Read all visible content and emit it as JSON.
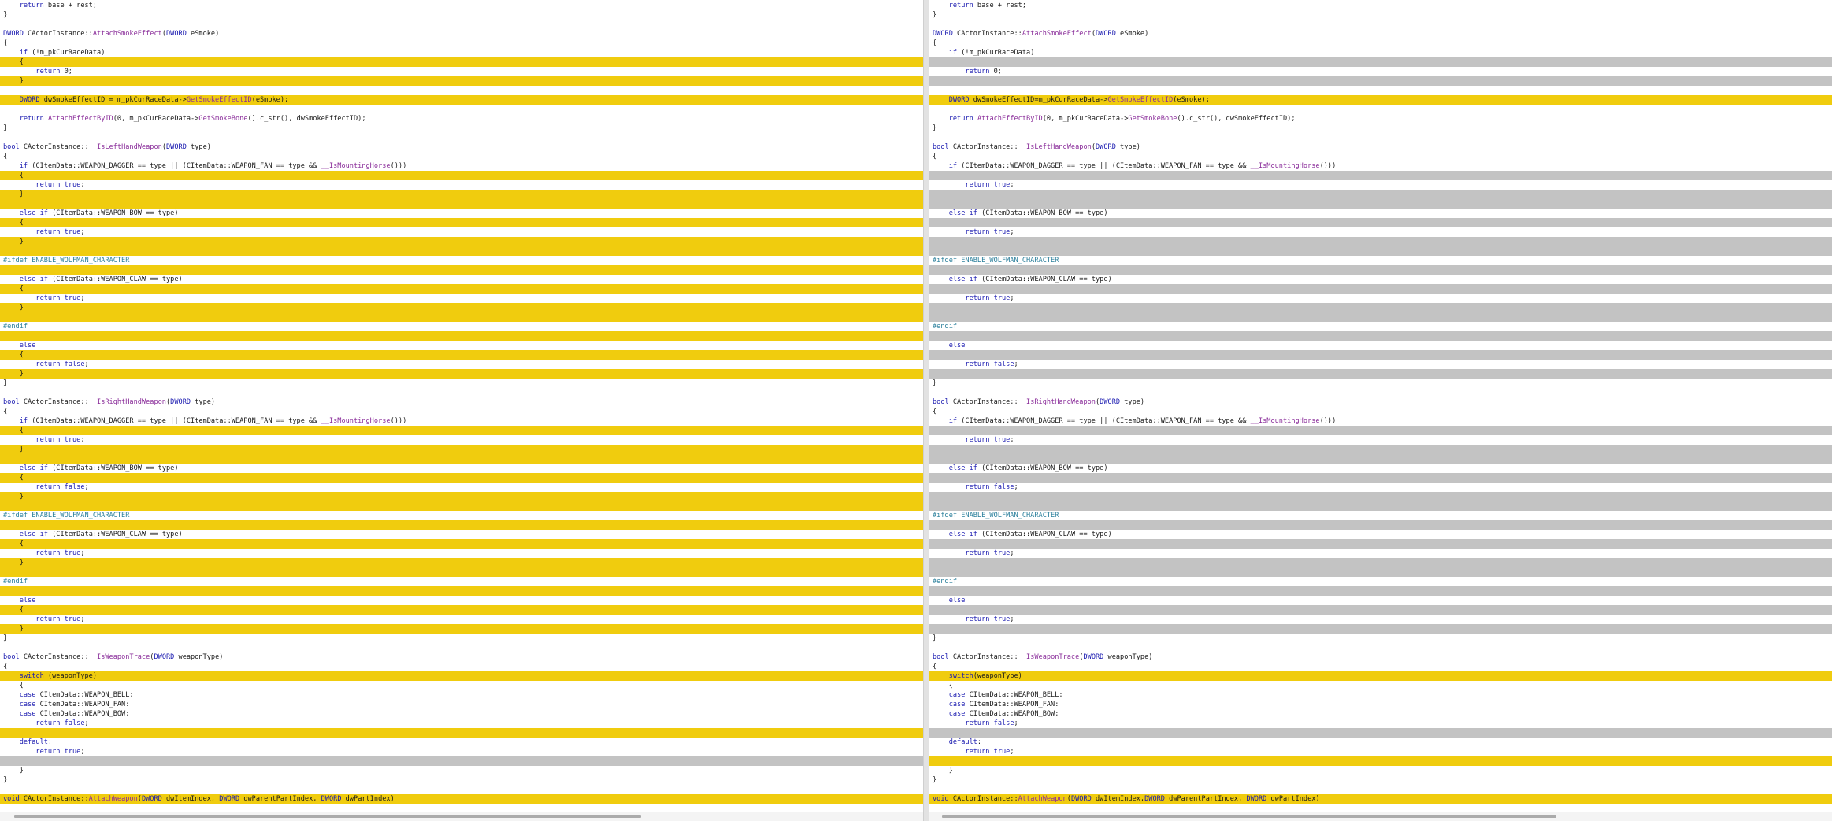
{
  "left": [
    {
      "t": "    return base + rest;",
      "s": "n"
    },
    {
      "t": "}",
      "s": "n"
    },
    {
      "t": "",
      "s": "n"
    },
    {
      "t": "DWORD CActorInstance::AttachSmokeEffect(DWORD eSmoke)",
      "s": "n"
    },
    {
      "t": "{",
      "s": "n"
    },
    {
      "t": "    if (!m_pkCurRaceData)",
      "s": "n"
    },
    {
      "t": "    {",
      "s": "ch"
    },
    {
      "t": "        return 0;",
      "s": "n"
    },
    {
      "t": "    }",
      "s": "ch"
    },
    {
      "t": "",
      "s": "n"
    },
    {
      "t": "    DWORD dwSmokeEffectID = m_pkCurRaceData->GetSmokeEffectID(eSmoke);",
      "s": "ch"
    },
    {
      "t": "",
      "s": "n"
    },
    {
      "t": "    return AttachEffectByID(0, m_pkCurRaceData->GetSmokeBone().c_str(), dwSmokeEffectID);",
      "s": "n"
    },
    {
      "t": "}",
      "s": "n"
    },
    {
      "t": "",
      "s": "n"
    },
    {
      "t": "bool CActorInstance::__IsLeftHandWeapon(DWORD type)",
      "s": "n"
    },
    {
      "t": "{",
      "s": "n"
    },
    {
      "t": "    if (CItemData::WEAPON_DAGGER == type || (CItemData::WEAPON_FAN == type && __IsMountingHorse()))",
      "s": "n"
    },
    {
      "t": "    {",
      "s": "ch"
    },
    {
      "t": "        return true;",
      "s": "n"
    },
    {
      "t": "    }",
      "s": "ch"
    },
    {
      "t": "",
      "s": "ch"
    },
    {
      "t": "    else if (CItemData::WEAPON_BOW == type)",
      "s": "n"
    },
    {
      "t": "    {",
      "s": "ch"
    },
    {
      "t": "        return true;",
      "s": "n"
    },
    {
      "t": "    }",
      "s": "ch"
    },
    {
      "t": "",
      "s": "ch"
    },
    {
      "t": "#ifdef ENABLE_WOLFMAN_CHARACTER",
      "s": "n"
    },
    {
      "t": "",
      "s": "ch"
    },
    {
      "t": "    else if (CItemData::WEAPON_CLAW == type)",
      "s": "n"
    },
    {
      "t": "    {",
      "s": "ch"
    },
    {
      "t": "        return true;",
      "s": "n"
    },
    {
      "t": "    }",
      "s": "ch"
    },
    {
      "t": "",
      "s": "ch"
    },
    {
      "t": "#endif",
      "s": "n"
    },
    {
      "t": "",
      "s": "ch"
    },
    {
      "t": "    else",
      "s": "n"
    },
    {
      "t": "    {",
      "s": "ch"
    },
    {
      "t": "        return false;",
      "s": "n"
    },
    {
      "t": "    }",
      "s": "ch"
    },
    {
      "t": "}",
      "s": "n"
    },
    {
      "t": "",
      "s": "n"
    },
    {
      "t": "bool CActorInstance::__IsRightHandWeapon(DWORD type)",
      "s": "n"
    },
    {
      "t": "{",
      "s": "n"
    },
    {
      "t": "    if (CItemData::WEAPON_DAGGER == type || (CItemData::WEAPON_FAN == type && __IsMountingHorse()))",
      "s": "n"
    },
    {
      "t": "    {",
      "s": "ch"
    },
    {
      "t": "        return true;",
      "s": "n"
    },
    {
      "t": "    }",
      "s": "ch"
    },
    {
      "t": "",
      "s": "ch"
    },
    {
      "t": "    else if (CItemData::WEAPON_BOW == type)",
      "s": "n"
    },
    {
      "t": "    {",
      "s": "ch"
    },
    {
      "t": "        return false;",
      "s": "n"
    },
    {
      "t": "    }",
      "s": "ch"
    },
    {
      "t": "",
      "s": "ch"
    },
    {
      "t": "#ifdef ENABLE_WOLFMAN_CHARACTER",
      "s": "n"
    },
    {
      "t": "",
      "s": "ch"
    },
    {
      "t": "    else if (CItemData::WEAPON_CLAW == type)",
      "s": "n"
    },
    {
      "t": "    {",
      "s": "ch"
    },
    {
      "t": "        return true;",
      "s": "n"
    },
    {
      "t": "    }",
      "s": "ch"
    },
    {
      "t": "",
      "s": "ch"
    },
    {
      "t": "#endif",
      "s": "n"
    },
    {
      "t": "",
      "s": "ch"
    },
    {
      "t": "    else",
      "s": "n"
    },
    {
      "t": "    {",
      "s": "ch"
    },
    {
      "t": "        return true;",
      "s": "n"
    },
    {
      "t": "    }",
      "s": "ch"
    },
    {
      "t": "}",
      "s": "n"
    },
    {
      "t": "",
      "s": "n"
    },
    {
      "t": "bool CActorInstance::__IsWeaponTrace(DWORD weaponType)",
      "s": "n"
    },
    {
      "t": "{",
      "s": "n"
    },
    {
      "t": "    switch (weaponType)",
      "s": "ch"
    },
    {
      "t": "    {",
      "s": "n"
    },
    {
      "t": "    case CItemData::WEAPON_BELL:",
      "s": "n"
    },
    {
      "t": "    case CItemData::WEAPON_FAN:",
      "s": "n"
    },
    {
      "t": "    case CItemData::WEAPON_BOW:",
      "s": "n"
    },
    {
      "t": "        return false;",
      "s": "n"
    },
    {
      "t": "",
      "s": "ch"
    },
    {
      "t": "    default:",
      "s": "n"
    },
    {
      "t": "        return true;",
      "s": "n"
    },
    {
      "t": "",
      "s": "gp"
    },
    {
      "t": "    }",
      "s": "n"
    },
    {
      "t": "}",
      "s": "n"
    },
    {
      "t": "",
      "s": "n"
    },
    {
      "t": "void CActorInstance::AttachWeapon(DWORD dwItemIndex, DWORD dwParentPartIndex, DWORD dwPartIndex)",
      "s": "ch"
    }
  ],
  "right": [
    {
      "t": "    return base + rest;",
      "s": "n"
    },
    {
      "t": "}",
      "s": "n"
    },
    {
      "t": "",
      "s": "n"
    },
    {
      "t": "DWORD CActorInstance::AttachSmokeEffect(DWORD eSmoke)",
      "s": "n"
    },
    {
      "t": "{",
      "s": "n"
    },
    {
      "t": "    if (!m_pkCurRaceData)",
      "s": "n"
    },
    {
      "t": "",
      "s": "gp"
    },
    {
      "t": "        return 0;",
      "s": "n"
    },
    {
      "t": "",
      "s": "gp"
    },
    {
      "t": "",
      "s": "n"
    },
    {
      "t": "    DWORD dwSmokeEffectID=m_pkCurRaceData->GetSmokeEffectID(eSmoke);",
      "s": "ch"
    },
    {
      "t": "",
      "s": "n"
    },
    {
      "t": "    return AttachEffectByID(0, m_pkCurRaceData->GetSmokeBone().c_str(), dwSmokeEffectID);",
      "s": "n"
    },
    {
      "t": "}",
      "s": "n"
    },
    {
      "t": "",
      "s": "n"
    },
    {
      "t": "bool CActorInstance::__IsLeftHandWeapon(DWORD type)",
      "s": "n"
    },
    {
      "t": "{",
      "s": "n"
    },
    {
      "t": "    if (CItemData::WEAPON_DAGGER == type || (CItemData::WEAPON_FAN == type && __IsMountingHorse()))",
      "s": "n"
    },
    {
      "t": "",
      "s": "gp"
    },
    {
      "t": "        return true;",
      "s": "n"
    },
    {
      "t": "",
      "s": "gp"
    },
    {
      "t": "",
      "s": "gp"
    },
    {
      "t": "    else if (CItemData::WEAPON_BOW == type)",
      "s": "n"
    },
    {
      "t": "",
      "s": "gp"
    },
    {
      "t": "        return true;",
      "s": "n"
    },
    {
      "t": "",
      "s": "gp"
    },
    {
      "t": "",
      "s": "gp"
    },
    {
      "t": "#ifdef ENABLE_WOLFMAN_CHARACTER",
      "s": "n"
    },
    {
      "t": "",
      "s": "gp"
    },
    {
      "t": "    else if (CItemData::WEAPON_CLAW == type)",
      "s": "n"
    },
    {
      "t": "",
      "s": "gp"
    },
    {
      "t": "        return true;",
      "s": "n"
    },
    {
      "t": "",
      "s": "gp"
    },
    {
      "t": "",
      "s": "gp"
    },
    {
      "t": "#endif",
      "s": "n"
    },
    {
      "t": "",
      "s": "gp"
    },
    {
      "t": "    else",
      "s": "n"
    },
    {
      "t": "",
      "s": "gp"
    },
    {
      "t": "        return false;",
      "s": "n"
    },
    {
      "t": "",
      "s": "gp"
    },
    {
      "t": "}",
      "s": "n"
    },
    {
      "t": "",
      "s": "n"
    },
    {
      "t": "bool CActorInstance::__IsRightHandWeapon(DWORD type)",
      "s": "n"
    },
    {
      "t": "{",
      "s": "n"
    },
    {
      "t": "    if (CItemData::WEAPON_DAGGER == type || (CItemData::WEAPON_FAN == type && __IsMountingHorse()))",
      "s": "n"
    },
    {
      "t": "",
      "s": "gp"
    },
    {
      "t": "        return true;",
      "s": "n"
    },
    {
      "t": "",
      "s": "gp"
    },
    {
      "t": "",
      "s": "gp"
    },
    {
      "t": "    else if (CItemData::WEAPON_BOW == type)",
      "s": "n"
    },
    {
      "t": "",
      "s": "gp"
    },
    {
      "t": "        return false;",
      "s": "n"
    },
    {
      "t": "",
      "s": "gp"
    },
    {
      "t": "",
      "s": "gp"
    },
    {
      "t": "#ifdef ENABLE_WOLFMAN_CHARACTER",
      "s": "n"
    },
    {
      "t": "",
      "s": "gp"
    },
    {
      "t": "    else if (CItemData::WEAPON_CLAW == type)",
      "s": "n"
    },
    {
      "t": "",
      "s": "gp"
    },
    {
      "t": "        return true;",
      "s": "n"
    },
    {
      "t": "",
      "s": "gp"
    },
    {
      "t": "",
      "s": "gp"
    },
    {
      "t": "#endif",
      "s": "n"
    },
    {
      "t": "",
      "s": "gp"
    },
    {
      "t": "    else",
      "s": "n"
    },
    {
      "t": "",
      "s": "gp"
    },
    {
      "t": "        return true;",
      "s": "n"
    },
    {
      "t": "",
      "s": "gp"
    },
    {
      "t": "}",
      "s": "n"
    },
    {
      "t": "",
      "s": "n"
    },
    {
      "t": "bool CActorInstance::__IsWeaponTrace(DWORD weaponType)",
      "s": "n"
    },
    {
      "t": "{",
      "s": "n"
    },
    {
      "t": "    switch(weaponType)",
      "s": "ch"
    },
    {
      "t": "    {",
      "s": "n"
    },
    {
      "t": "    case CItemData::WEAPON_BELL:",
      "s": "n"
    },
    {
      "t": "    case CItemData::WEAPON_FAN:",
      "s": "n"
    },
    {
      "t": "    case CItemData::WEAPON_BOW:",
      "s": "n"
    },
    {
      "t": "        return false;",
      "s": "n"
    },
    {
      "t": "",
      "s": "gp"
    },
    {
      "t": "    default:",
      "s": "n"
    },
    {
      "t": "        return true;",
      "s": "n"
    },
    {
      "t": "",
      "s": "ch"
    },
    {
      "t": "    }",
      "s": "n"
    },
    {
      "t": "}",
      "s": "n"
    },
    {
      "t": "",
      "s": "n"
    },
    {
      "t": "void CActorInstance::AttachWeapon(DWORD dwItemIndex,DWORD dwParentPartIndex, DWORD dwPartIndex)",
      "s": "ch"
    }
  ],
  "colors": {
    "changed": "#f0cc0e",
    "gap": "#c3c3c3",
    "keyword": "#1a1ab0",
    "function": "#8a2d9a",
    "preprocessor": "#2a7f9b"
  }
}
